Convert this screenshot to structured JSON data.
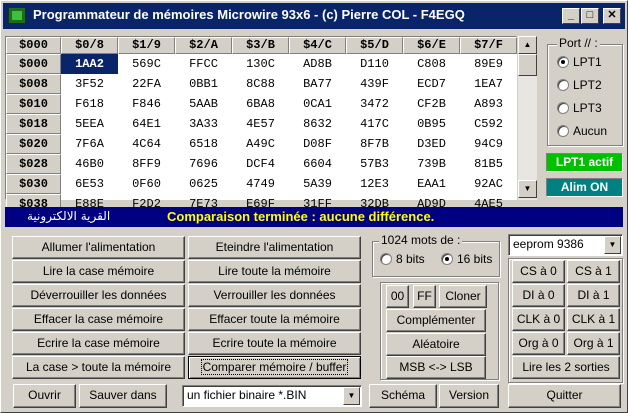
{
  "window": {
    "title": "Programmateur de mémoires Microwire 93x6 - (c) Pierre COL - F4EGQ",
    "minimize_glyph": "_",
    "maximize_glyph": "□",
    "close_glyph": "✕"
  },
  "grid": {
    "corner": "$000",
    "columns": [
      "$0/8",
      "$1/9",
      "$2/A",
      "$3/B",
      "$4/C",
      "$5/D",
      "$6/E",
      "$7/F"
    ],
    "rows": [
      {
        "addr": "$000",
        "cells": [
          "1AA2",
          "569C",
          "FFCC",
          "130C",
          "AD8B",
          "D110",
          "C808",
          "89E9"
        ]
      },
      {
        "addr": "$008",
        "cells": [
          "3F52",
          "22FA",
          "0BB1",
          "8C88",
          "BA77",
          "439F",
          "ECD7",
          "1EA7"
        ]
      },
      {
        "addr": "$010",
        "cells": [
          "F618",
          "F846",
          "5AAB",
          "6BA8",
          "0CA1",
          "3472",
          "CF2B",
          "A893"
        ]
      },
      {
        "addr": "$018",
        "cells": [
          "5EEA",
          "64E1",
          "3A33",
          "4E57",
          "8632",
          "417C",
          "0B95",
          "C592"
        ]
      },
      {
        "addr": "$020",
        "cells": [
          "7F6A",
          "4C64",
          "6518",
          "A49C",
          "D08F",
          "8F7B",
          "D3ED",
          "94C9"
        ]
      },
      {
        "addr": "$028",
        "cells": [
          "46B0",
          "8FF9",
          "7696",
          "DCF4",
          "6604",
          "57B3",
          "739B",
          "81B5"
        ]
      },
      {
        "addr": "$030",
        "cells": [
          "6E53",
          "0F60",
          "0625",
          "4749",
          "5A39",
          "12E3",
          "EAA1",
          "92AC"
        ]
      },
      {
        "addr": "$038",
        "cells": [
          "E88E",
          "F2D2",
          "7E73",
          "E69F",
          "31FF",
          "32DB",
          "AD9D",
          "4AE5"
        ]
      }
    ],
    "selected": "row 0 col 0",
    "scroll_up": "▲",
    "scroll_down": "▼"
  },
  "port": {
    "legend": "Port // :",
    "options": [
      "LPT1",
      "LPT2",
      "LPT3",
      "Aucun"
    ],
    "selected": "LPT1"
  },
  "badges": {
    "lpt_active": "LPT1 actif",
    "lpt_active_bg": "#00c000",
    "lpt_active_fg": "#ffffff",
    "alim": "Alim ON",
    "alim_bg": "#008080",
    "alim_fg": "#ffffff"
  },
  "status": {
    "arabic": "القرية الالكترونية",
    "message": "Comparaison terminée : aucune différence."
  },
  "buttons_left": [
    [
      "Allumer l'alimentation",
      "Eteindre l'alimentation"
    ],
    [
      "Lire la case mémoire",
      "Lire toute la mémoire"
    ],
    [
      "Déverrouiller les données",
      "Verrouiller les données"
    ],
    [
      "Effacer la case mémoire",
      "Effacer toute la mémoire"
    ],
    [
      "Ecrire la case mémoire",
      "Ecrire toute la mémoire"
    ],
    [
      "La case > toute la mémoire",
      "Comparer mémoire / buffer"
    ]
  ],
  "words": {
    "legend": "1024 mots de :",
    "options": [
      "8 bits",
      "16 bits"
    ],
    "selected": "16 bits"
  },
  "middle": {
    "btn_00": "00",
    "btn_ff": "FF",
    "btn_clone": "Cloner",
    "complement": "Complémenter",
    "random": "Aléatoire",
    "msb_lsb": "MSB <-> LSB"
  },
  "chip": {
    "selected": "eeprom 9386"
  },
  "pins": [
    [
      "CS à 0",
      "CS à 1"
    ],
    [
      "DI à 0",
      "DI à 1"
    ],
    [
      "CLK à 0",
      "CLK à 1"
    ],
    [
      "Org à 0",
      "Org à 1"
    ]
  ],
  "read_outputs": "Lire les 2 sorties",
  "bottom": {
    "open": "Ouvrir",
    "save_in": "Sauver dans",
    "file_type": "un fichier binaire *.BIN",
    "schema": "Schéma",
    "version": "Version",
    "quit": "Quitter"
  }
}
